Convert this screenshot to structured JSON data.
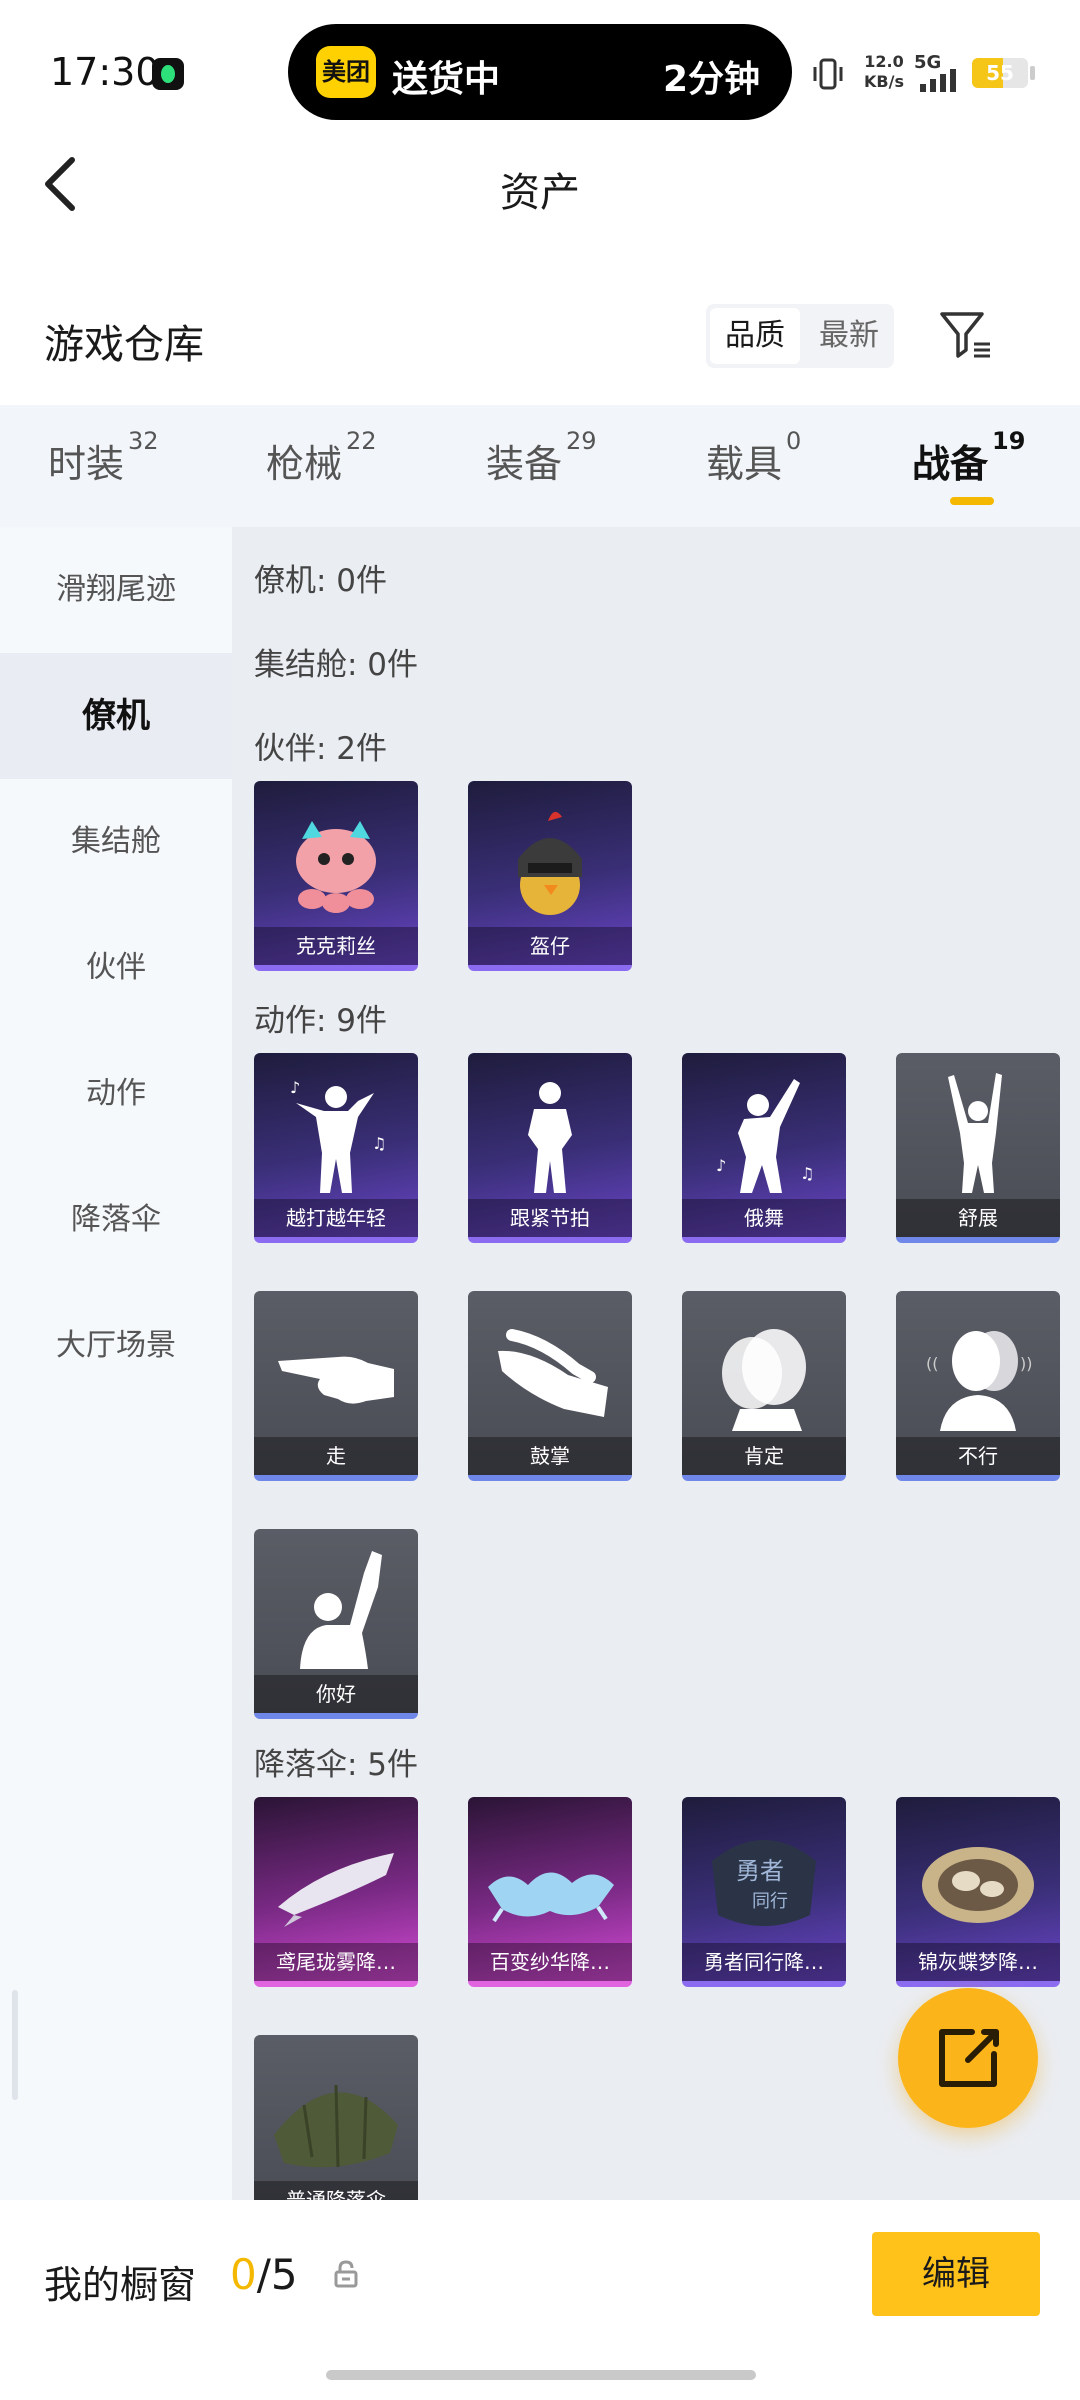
{
  "status_bar": {
    "time": "17:30",
    "island_app": "美团",
    "island_status": "送货中",
    "island_eta": "2分钟",
    "net_speed_value": "12.0",
    "net_speed_unit": "KB/s",
    "network": "5G",
    "battery": "55",
    "battery_level": 0.55
  },
  "nav": {
    "title": "资产"
  },
  "section": {
    "title": "游戏仓库",
    "sort_options": [
      "品质",
      "最新"
    ],
    "sort_selected": "品质"
  },
  "tabs": [
    {
      "label": "时装",
      "count": "32"
    },
    {
      "label": "枪械",
      "count": "22"
    },
    {
      "label": "装备",
      "count": "29"
    },
    {
      "label": "载具",
      "count": "0"
    },
    {
      "label": "战备",
      "count": "19",
      "active": true
    }
  ],
  "sidebar": {
    "items": [
      "滑翔尾迹",
      "僚机",
      "集结舱",
      "伙伴",
      "动作",
      "降落伞",
      "大厅场景"
    ],
    "active": "僚机"
  },
  "groups": {
    "wingman": "僚机: 0件",
    "capsule": "集结舱: 0件",
    "partner": "伙伴: 2件",
    "emote": "动作: 9件",
    "parachute": "降落伞: 5件"
  },
  "partner_items": [
    "克克莉丝",
    "盔仔"
  ],
  "emote_items": [
    "越打越年轻",
    "跟紧节拍",
    "俄舞",
    "舒展",
    "走",
    "鼓掌",
    "肯定",
    "不行",
    "你好"
  ],
  "parachute_items": [
    "鸢尾珑雾降…",
    "百变纱华降…",
    "勇者同行降…",
    "锦灰蝶梦降…",
    "普通降落伞"
  ],
  "showcase": {
    "title": "我的橱窗",
    "current": "0",
    "total": "/5",
    "edit_label": "编辑"
  },
  "colors": {
    "accent": "#f5b800",
    "fab": "#fbb51a",
    "purple_card": "#3a2f78",
    "grey_card": "#4a4c55",
    "pink_card": "#7b2a86"
  }
}
